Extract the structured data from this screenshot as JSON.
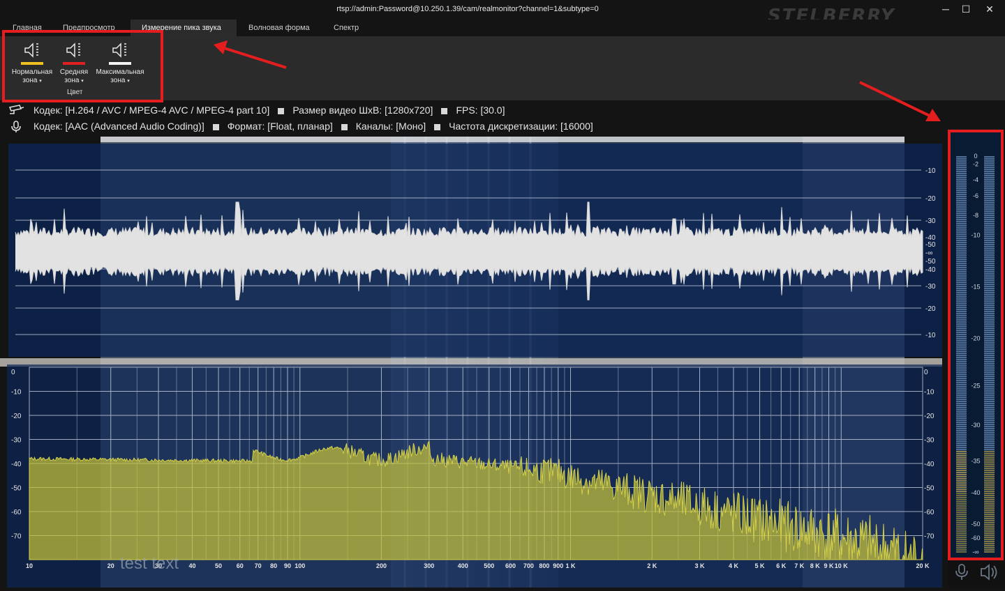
{
  "window": {
    "title": "rtsp://admin:Password@10.250.1.39/cam/realmonitor?channel=1&subtype=0",
    "brand": "STELBERRY",
    "controls": [
      "─",
      "☐",
      "✕"
    ]
  },
  "tabs": [
    {
      "label": "Главная",
      "active": false
    },
    {
      "label": "Предпросмотр",
      "active": false
    },
    {
      "label": "Измерение пика звука",
      "active": true
    },
    {
      "label": "Волновая форма",
      "active": false
    },
    {
      "label": "Спектр",
      "active": false
    }
  ],
  "ribbon": {
    "group_label": "Цвет",
    "buttons": [
      {
        "line1": "Нормальная",
        "line2": "зона",
        "color": "#f0c020",
        "icon": "speaker-icon"
      },
      {
        "line1": "Средняя",
        "line2": "зона",
        "color": "#e02020",
        "icon": "speaker-icon"
      },
      {
        "line1": "Максимальная",
        "line2": "зона",
        "color": "#f4f4f4",
        "icon": "speaker-icon"
      }
    ]
  },
  "video_info": {
    "icon": "camera-icon",
    "items": [
      "Кодек: [H.264 / AVC / MPEG-4 AVC / MPEG-4 part 10]",
      "Размер видео ШxВ: [1280x720]",
      "FPS: [30.0]"
    ]
  },
  "audio_info": {
    "icon": "microphone-icon",
    "items": [
      "Кодек: [AAC (Advanced Audio Coding)]",
      "Формат: [Float, планар]",
      "Каналы: [Моно]",
      "Частота дискретизации: [16000]"
    ]
  },
  "waveform": {
    "right_labels": [
      "-10",
      "-20",
      "-30",
      "-40",
      "-50",
      "-∞",
      "-50",
      "-40",
      "-30",
      "-20",
      "-10"
    ]
  },
  "spectrum": {
    "y_labels": [
      "0",
      "-10",
      "-20",
      "-30",
      "-40",
      "-50",
      "-60",
      "-70"
    ],
    "x_labels": [
      "10",
      "20",
      "30",
      "40",
      "50",
      "60",
      "70",
      "80",
      "90",
      "100",
      "200",
      "300",
      "400",
      "500",
      "600",
      "700",
      "800",
      "900",
      "1 K",
      "2 K",
      "3 K",
      "4 K",
      "5 K",
      "6 K",
      "7 K",
      "8 K",
      "9 K",
      "10 K",
      "20 K"
    ],
    "overlay_text": "test text",
    "fill_color": "#c6c23a"
  },
  "peak_meter": {
    "scale": [
      "0",
      "-2",
      "-4",
      "-6",
      "-8",
      "-10",
      "-15",
      "-20",
      "-25",
      "-30",
      "-35",
      "-40",
      "-50",
      "-60",
      "-∞"
    ],
    "level_db": -34,
    "footer_icons": [
      "microphone-icon",
      "speaker-icon"
    ]
  },
  "colors": {
    "accent_red": "#e41e1e",
    "panel_blue": "#0c2556",
    "waveform": "#d8d8d8"
  }
}
